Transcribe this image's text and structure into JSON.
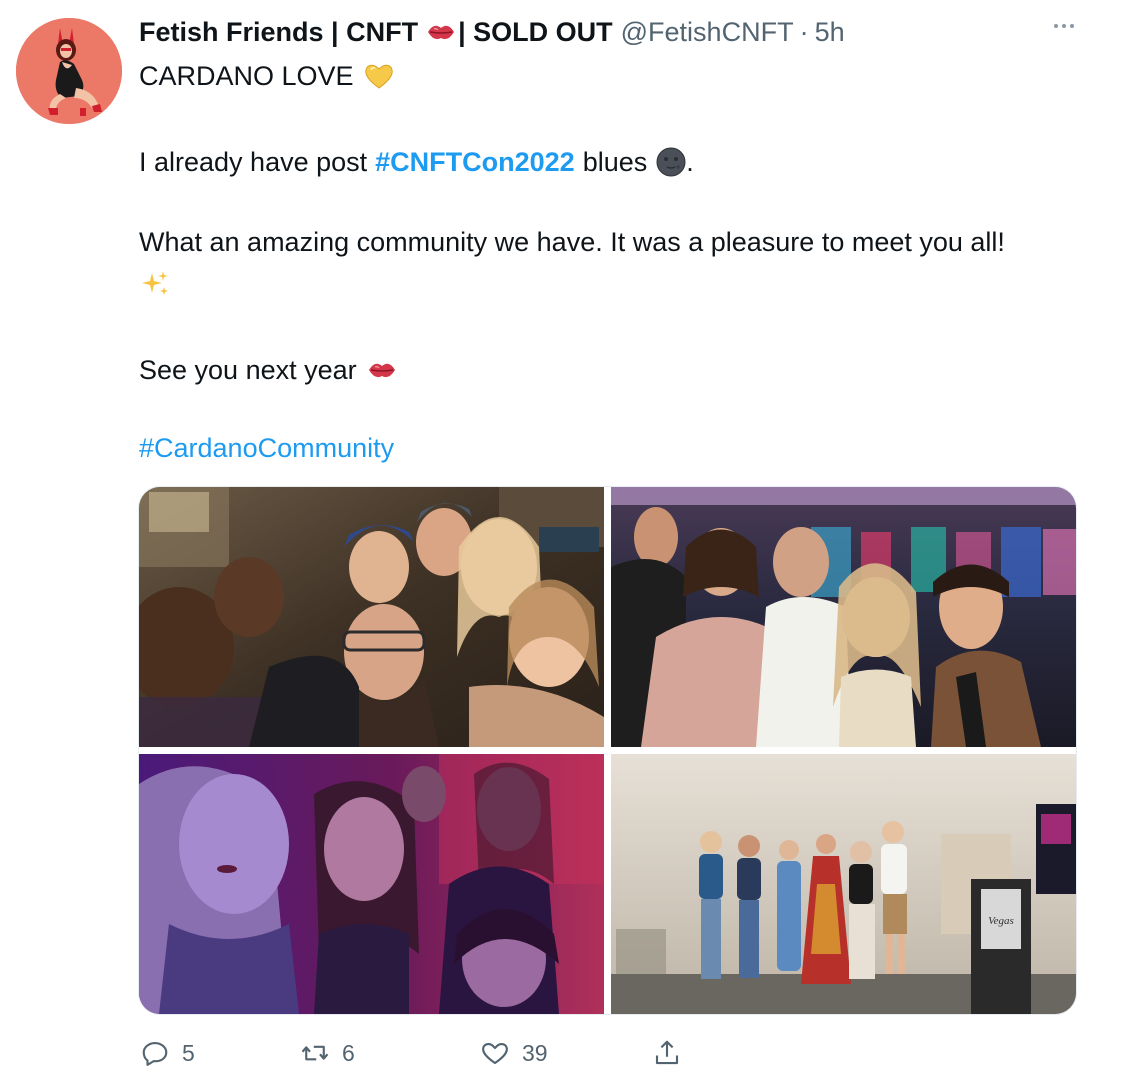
{
  "tweet": {
    "display_name_part1": "Fetish Friends | CNFT",
    "display_name_part2": "| SOLD OUT",
    "handle": "@FetishCNFT",
    "separator": "·",
    "time": "5h",
    "lines": {
      "l1": "CARDANO LOVE",
      "l2a": "I already have post",
      "l2_hashtag": "#CNFTCon2022",
      "l2b": "blues",
      "l2c": ".",
      "l3": "What an amazing community we have. It was a pleasure to meet you all!",
      "l5": "See you next year",
      "l6_hashtag": "#CardanoCommunity"
    },
    "photos": [
      {
        "alt": "casino selfie group"
      },
      {
        "alt": "casino group peace sign"
      },
      {
        "alt": "purple lit group selfie"
      },
      {
        "alt": "group on stage Vegas"
      }
    ],
    "podium_text": "Vegas",
    "actions": {
      "replies": "5",
      "retweets": "6",
      "likes": "39"
    },
    "icons": {
      "reply": "reply-icon",
      "retweet": "retweet-icon",
      "like": "heart-icon",
      "share": "share-icon",
      "more": "more-icon"
    },
    "colors": {
      "link": "#1d9bf0",
      "secondary": "#536471",
      "avatar_bg": "#ec7867"
    }
  }
}
